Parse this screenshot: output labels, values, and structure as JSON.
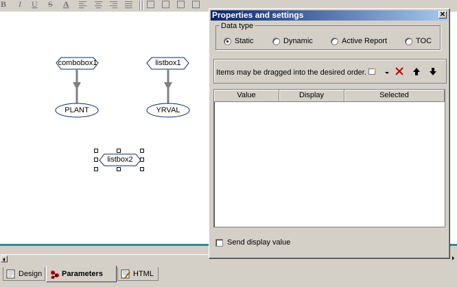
{
  "toolbar": {
    "bold": "B",
    "italic": "I",
    "underline": "U",
    "strike": "S",
    "font_color": "A"
  },
  "canvas": {
    "nodes": [
      {
        "id": "combobox1",
        "label": "combobox1",
        "kind": "hexagon"
      },
      {
        "id": "listbox1",
        "label": "listbox1",
        "kind": "hexagon"
      },
      {
        "id": "plant",
        "label": "PLANT",
        "kind": "ellipse"
      },
      {
        "id": "yrval",
        "label": "YRVAL",
        "kind": "ellipse"
      },
      {
        "id": "listbox2",
        "label": "listbox2",
        "kind": "hexagon",
        "selected": true
      }
    ]
  },
  "tabs": [
    {
      "label": "Design",
      "icon": "design-icon",
      "active": false
    },
    {
      "label": "Parameters",
      "icon": "parameters-icon",
      "active": true
    },
    {
      "label": "HTML",
      "icon": "html-icon",
      "active": false
    }
  ],
  "dialog": {
    "title": "Properties and settings",
    "close": "✕",
    "data_type": {
      "legend": "Data type",
      "options": [
        {
          "label": "Static",
          "checked": true
        },
        {
          "label": "Dynamic",
          "checked": false
        },
        {
          "label": "Active Report",
          "checked": false
        },
        {
          "label": "TOC",
          "checked": false
        }
      ]
    },
    "drag_hint": "Items may be dragged into the desired order.",
    "grid": {
      "columns": [
        "Value",
        "Display",
        "Selected"
      ],
      "rows": []
    },
    "send_display_value": {
      "label": "Send display value",
      "checked": false
    }
  },
  "colors": {
    "titlebar_start": "#0a246a",
    "titlebar_end": "#a6caf0",
    "teal_line": "#2f8a8a",
    "node_stroke": "#0a246a"
  }
}
